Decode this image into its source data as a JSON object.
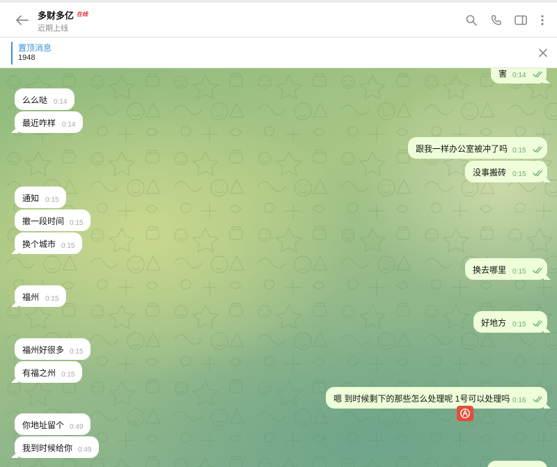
{
  "header": {
    "title": "多财多亿",
    "badge": "在线",
    "status": "近期上线",
    "icons": [
      "back-arrow-icon",
      "search-icon",
      "phone-icon",
      "sidebar-panel-icon",
      "more-vertical-icon"
    ]
  },
  "pinned": {
    "title": "置顶消息",
    "text": "1948"
  },
  "messages": {
    "m0": {
      "text": "害",
      "time": "0:14",
      "side": "out"
    },
    "m1": {
      "text": "么么哒",
      "time": "0:14",
      "side": "in"
    },
    "m2": {
      "text": "最近咋样",
      "time": "0:14",
      "side": "in"
    },
    "m3": {
      "text": "跟我一样办公室被冲了吗",
      "time": "0:15",
      "side": "out"
    },
    "m4": {
      "text": "没事搬砖",
      "time": "0:15",
      "side": "out"
    },
    "m5": {
      "text": "通知",
      "time": "0:15",
      "side": "in"
    },
    "m6": {
      "text": "撤一段时间",
      "time": "0:15",
      "side": "in"
    },
    "m7": {
      "text": "换个城市",
      "time": "0:15",
      "side": "in"
    },
    "m8": {
      "text": "换去哪里",
      "time": "0:15",
      "side": "out"
    },
    "m9": {
      "text": "福州",
      "time": "0:15",
      "side": "in"
    },
    "m10": {
      "text": "好地方",
      "time": "0:15",
      "side": "out"
    },
    "m11": {
      "text": "福州好很多",
      "time": "0:15",
      "side": "in"
    },
    "m12": {
      "text": "有福之州",
      "time": "0:15",
      "side": "in"
    },
    "m13": {
      "text": "嗯 到时候剩下的那些怎么处理呢 1号可以处理吗",
      "time": "0:16",
      "side": "out"
    },
    "m14": {
      "text": "你地址留个",
      "time": "0:49",
      "side": "in"
    },
    "m15": {
      "text": "我到时候给你",
      "time": "0:49",
      "side": "in"
    }
  },
  "colors": {
    "accent": "#3b92d6",
    "outgoing_bubble": "#eefed9",
    "incoming_bubble": "#ffffff",
    "read_check": "#6aa96f",
    "reaction_badge": "#e24e3a",
    "online_badge": "#e0303a"
  }
}
